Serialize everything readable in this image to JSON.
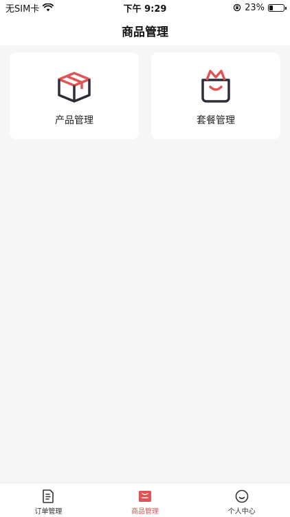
{
  "status_bar": {
    "carrier": "无SIM卡",
    "time": "下午 9:29",
    "battery_percent": "23%",
    "battery_level": 0.23
  },
  "header": {
    "title": "商品管理"
  },
  "cards": [
    {
      "label": "产品管理",
      "icon": "product-box-icon"
    },
    {
      "label": "套餐管理",
      "icon": "package-bag-icon"
    }
  ],
  "tab_bar": {
    "tabs": [
      {
        "label": "订单管理",
        "icon": "order-document-icon",
        "active": false
      },
      {
        "label": "商品管理",
        "icon": "goods-bag-icon",
        "active": true
      },
      {
        "label": "个人中心",
        "icon": "smiley-face-icon",
        "active": false
      }
    ]
  },
  "colors": {
    "accent": "#e15354",
    "icon_dark": "#2d2d3a",
    "background": "#f6f6f6"
  }
}
